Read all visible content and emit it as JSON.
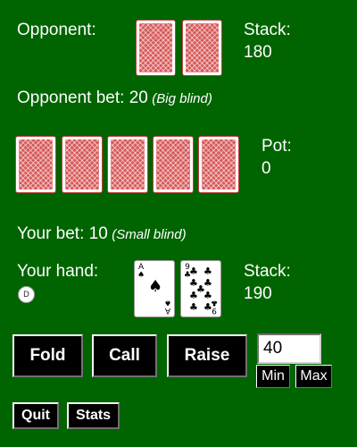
{
  "opponent": {
    "label": "Opponent:",
    "stack_label": "Stack:",
    "stack": "180",
    "bet_label": "Opponent bet: 20",
    "bet_note": "(Big blind)",
    "hole_cards": [
      "face-down",
      "face-down"
    ]
  },
  "board": {
    "cards": [
      "face-down",
      "face-down",
      "face-down",
      "face-down",
      "face-down"
    ],
    "pot_label": "Pot:",
    "pot": "0"
  },
  "player": {
    "bet_label": "Your bet: 10",
    "bet_note": "(Small blind)",
    "hand_label": "Your hand:",
    "dealer_button": "D",
    "stack_label": "Stack:",
    "stack": "190",
    "cards": [
      {
        "rank": "A",
        "suit": "♠",
        "color": "#000000"
      },
      {
        "rank": "9",
        "suit": "♣",
        "color": "#000000"
      }
    ]
  },
  "actions": {
    "fold": "Fold",
    "call": "Call",
    "raise": "Raise",
    "raise_amount": "40",
    "min": "Min",
    "max": "Max"
  },
  "footer": {
    "quit": "Quit",
    "stats": "Stats"
  },
  "colors": {
    "table": "#006400",
    "card_back": "#d85a5a",
    "button": "#000000"
  }
}
